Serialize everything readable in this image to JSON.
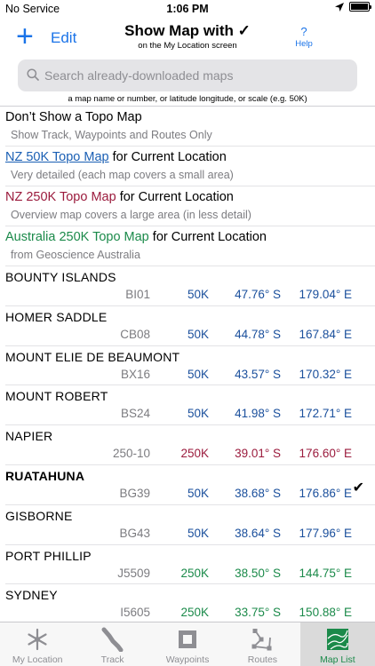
{
  "status_bar": {
    "carrier": "No Service",
    "time": "1:06 PM"
  },
  "nav": {
    "add_label": "+",
    "edit_label": "Edit",
    "title": "Show Map with ✓",
    "subtitle": "on the My Location screen",
    "help_icon": "?",
    "help_label": "Help"
  },
  "search": {
    "placeholder": "Search already-downloaded maps",
    "hint": "a map name or number, or latitude longitude, or scale (e.g. 50K)"
  },
  "options": [
    {
      "title": "Don’t Show a Topo Map",
      "suffix": "",
      "subtitle": "Show Track, Waypoints and Routes Only",
      "style": "plain"
    },
    {
      "title": "NZ 50K Topo Map",
      "suffix": " for Current Location",
      "subtitle": "Very detailed (each map covers a small area)",
      "style": "blue-link"
    },
    {
      "title": "NZ 250K Topo Map",
      "suffix": " for Current Location",
      "subtitle": "Overview map covers a large area (in less detail)",
      "style": "red"
    },
    {
      "title": "Australia 250K Topo Map",
      "suffix": " for Current Location",
      "subtitle": "from Geoscience Australia",
      "style": "green"
    }
  ],
  "maps": [
    {
      "name": "BOUNTY ISLANDS",
      "code": "BI01",
      "scale": "50K",
      "lat": "47.76° S",
      "lon": "179.04° E",
      "color": "blue",
      "selected": false
    },
    {
      "name": "HOMER SADDLE",
      "code": "CB08",
      "scale": "50K",
      "lat": "44.78° S",
      "lon": "167.84° E",
      "color": "blue",
      "selected": false
    },
    {
      "name": "MOUNT ELIE DE BEAUMONT",
      "code": "BX16",
      "scale": "50K",
      "lat": "43.57° S",
      "lon": "170.32° E",
      "color": "blue",
      "selected": false
    },
    {
      "name": "MOUNT ROBERT",
      "code": "BS24",
      "scale": "50K",
      "lat": "41.98° S",
      "lon": "172.71° E",
      "color": "blue",
      "selected": false
    },
    {
      "name": "NAPIER",
      "code": "250-10",
      "scale": "250K",
      "lat": "39.01° S",
      "lon": "176.60° E",
      "color": "red",
      "selected": false
    },
    {
      "name": "RUATAHUNA",
      "code": "BG39",
      "scale": "50K",
      "lat": "38.68° S",
      "lon": "176.86° E",
      "color": "blue",
      "selected": true
    },
    {
      "name": "GISBORNE",
      "code": "BG43",
      "scale": "50K",
      "lat": "38.64° S",
      "lon": "177.96° E",
      "color": "blue",
      "selected": false
    },
    {
      "name": "PORT PHILLIP",
      "code": "J5509",
      "scale": "250K",
      "lat": "38.50° S",
      "lon": "144.75° E",
      "color": "green",
      "selected": false
    },
    {
      "name": "SYDNEY",
      "code": "I5605",
      "scale": "250K",
      "lat": "33.75° S",
      "lon": "150.88° E",
      "color": "green",
      "selected": false
    }
  ],
  "check_mark": "✔",
  "tabs": [
    {
      "label": "My Location",
      "icon": "location-snowflake-icon",
      "active": false
    },
    {
      "label": "Track",
      "icon": "track-icon",
      "active": false
    },
    {
      "label": "Waypoints",
      "icon": "waypoints-icon",
      "active": false
    },
    {
      "label": "Routes",
      "icon": "routes-icon",
      "active": false
    },
    {
      "label": "Map List",
      "icon": "map-list-icon",
      "active": true
    }
  ],
  "colors": {
    "accent": "#1a73e8",
    "nz50k": "#1a4f9c",
    "nz250k": "#9b1b3d",
    "aus250k": "#1b8a4a"
  }
}
